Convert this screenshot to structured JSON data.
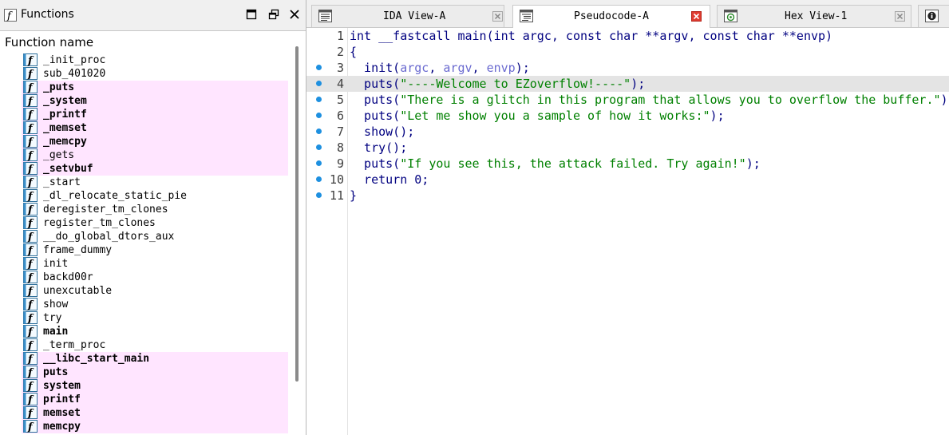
{
  "functions_panel": {
    "title": "Functions",
    "column_header": "Function name",
    "items": [
      {
        "name": "_init_proc",
        "lib": false,
        "bold": false
      },
      {
        "name": "sub_401020",
        "lib": false,
        "bold": false
      },
      {
        "name": "_puts",
        "lib": true,
        "bold": true
      },
      {
        "name": "_system",
        "lib": true,
        "bold": true
      },
      {
        "name": "_printf",
        "lib": true,
        "bold": true
      },
      {
        "name": "_memset",
        "lib": true,
        "bold": true
      },
      {
        "name": "_memcpy",
        "lib": true,
        "bold": true
      },
      {
        "name": "_gets",
        "lib": true,
        "bold": false
      },
      {
        "name": "_setvbuf",
        "lib": true,
        "bold": true
      },
      {
        "name": "_start",
        "lib": false,
        "bold": false
      },
      {
        "name": "_dl_relocate_static_pie",
        "lib": false,
        "bold": false
      },
      {
        "name": "deregister_tm_clones",
        "lib": false,
        "bold": false
      },
      {
        "name": "register_tm_clones",
        "lib": false,
        "bold": false
      },
      {
        "name": "__do_global_dtors_aux",
        "lib": false,
        "bold": false
      },
      {
        "name": "frame_dummy",
        "lib": false,
        "bold": false
      },
      {
        "name": "init",
        "lib": false,
        "bold": false
      },
      {
        "name": "backd00r",
        "lib": false,
        "bold": false
      },
      {
        "name": "unexcutable",
        "lib": false,
        "bold": false
      },
      {
        "name": "show",
        "lib": false,
        "bold": false
      },
      {
        "name": "try",
        "lib": false,
        "bold": false
      },
      {
        "name": "main",
        "lib": false,
        "bold": true
      },
      {
        "name": "_term_proc",
        "lib": false,
        "bold": false
      },
      {
        "name": "__libc_start_main",
        "lib": true,
        "bold": true
      },
      {
        "name": "puts",
        "lib": true,
        "bold": true
      },
      {
        "name": "system",
        "lib": true,
        "bold": true
      },
      {
        "name": "printf",
        "lib": true,
        "bold": true
      },
      {
        "name": "memset",
        "lib": true,
        "bold": true
      },
      {
        "name": "memcpy",
        "lib": true,
        "bold": true
      }
    ]
  },
  "tabs": [
    {
      "label": "IDA View-A",
      "icon": "disassembly-icon",
      "active": false
    },
    {
      "label": "Pseudocode-A",
      "icon": "pseudocode-icon",
      "active": true
    },
    {
      "label": "Hex View-1",
      "icon": "hex-view-icon",
      "active": false
    }
  ],
  "pseudocode": {
    "highlighted_line": 4,
    "lines": [
      {
        "num": "1",
        "dot": false,
        "tokens": [
          {
            "t": "int __fastcall main(int argc, const char **argv, const char **envp)",
            "c": "code"
          }
        ]
      },
      {
        "num": "2",
        "dot": false,
        "tokens": [
          {
            "t": "{",
            "c": "code"
          }
        ]
      },
      {
        "num": "3",
        "dot": true,
        "tokens": [
          {
            "t": "  init(",
            "c": "code"
          },
          {
            "t": "argc",
            "c": "var"
          },
          {
            "t": ", ",
            "c": "code"
          },
          {
            "t": "argv",
            "c": "var"
          },
          {
            "t": ", ",
            "c": "code"
          },
          {
            "t": "envp",
            "c": "var"
          },
          {
            "t": ");",
            "c": "code"
          }
        ]
      },
      {
        "num": "4",
        "dot": true,
        "tokens": [
          {
            "t": "  puts(",
            "c": "code"
          },
          {
            "t": "\"----Welcome to EZoverflow!----\"",
            "c": "str"
          },
          {
            "t": ");",
            "c": "code"
          }
        ]
      },
      {
        "num": "5",
        "dot": true,
        "tokens": [
          {
            "t": "  puts(",
            "c": "code"
          },
          {
            "t": "\"There is a glitch in this program that allows you to overflow the buffer.\"",
            "c": "str"
          },
          {
            "t": ");",
            "c": "code"
          }
        ]
      },
      {
        "num": "6",
        "dot": true,
        "tokens": [
          {
            "t": "  puts(",
            "c": "code"
          },
          {
            "t": "\"Let me show you a sample of how it works:\"",
            "c": "str"
          },
          {
            "t": ");",
            "c": "code"
          }
        ]
      },
      {
        "num": "7",
        "dot": true,
        "tokens": [
          {
            "t": "  show();",
            "c": "code"
          }
        ]
      },
      {
        "num": "8",
        "dot": true,
        "tokens": [
          {
            "t": "  try();",
            "c": "code"
          }
        ]
      },
      {
        "num": "9",
        "dot": true,
        "tokens": [
          {
            "t": "  puts(",
            "c": "code"
          },
          {
            "t": "\"If you see this, the attack failed. Try again!\"",
            "c": "str"
          },
          {
            "t": ");",
            "c": "code"
          }
        ]
      },
      {
        "num": "10",
        "dot": true,
        "tokens": [
          {
            "t": "  return 0;",
            "c": "code"
          }
        ]
      },
      {
        "num": "11",
        "dot": true,
        "tokens": [
          {
            "t": "}",
            "c": "code"
          }
        ]
      }
    ]
  },
  "colors": {
    "lib_function_bg": "#ffe5ff",
    "highlight_line_bg": "#e4e4e4",
    "breakpoint_dot": "#1e90e0",
    "string_color": "#008000",
    "variable_color": "#6a6ad0",
    "code_color": "#000080"
  }
}
